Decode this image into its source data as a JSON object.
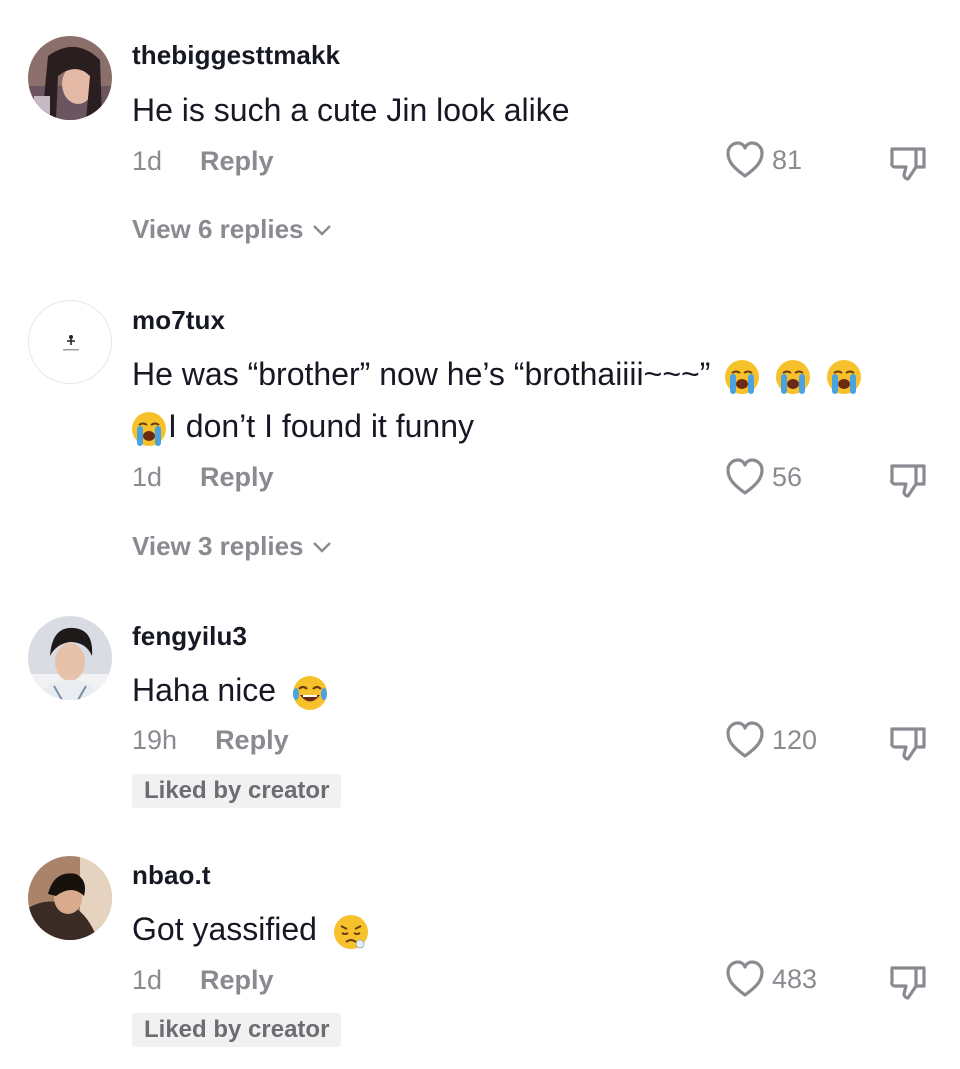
{
  "comments": [
    {
      "username": "thebiggesttmakk",
      "lines": [
        "He is such a cute Jin look alike"
      ],
      "time": "1d",
      "reply_label": "Reply",
      "likes": "81",
      "view_replies": "View 6 replies",
      "avatar_icon": "user-photo-avatar"
    },
    {
      "username": "mo7tux",
      "lines": [
        "He was “brother” now he’s “brothaiiii~~~”",
        "I don’t I found it funny"
      ],
      "time": "1d",
      "reply_label": "Reply",
      "likes": "56",
      "view_replies": "View 3 replies",
      "avatar_icon": "minimal-logo-avatar"
    },
    {
      "username": "fengyilu3",
      "lines": [
        "Haha nice"
      ],
      "time": "19h",
      "reply_label": "Reply",
      "likes": "120",
      "badge": "Liked by creator",
      "avatar_icon": "user-photo-avatar"
    },
    {
      "username": "nbao.t",
      "lines": [
        "Got yassified"
      ],
      "time": "1d",
      "reply_label": "Reply",
      "likes": "483",
      "badge": "Liked by creator",
      "avatar_icon": "user-photo-avatar"
    }
  ],
  "colors": {
    "text": "#161823",
    "muted": "#8a8b91",
    "badge_bg": "#f1f1f2"
  },
  "icons": {
    "like": "heart-outline-icon",
    "dislike": "thumbs-down-icon",
    "expand": "chevron-down-icon",
    "emoji_cry": "loudly-crying-face-emoji",
    "emoji_laugh": "tears-of-joy-emoji",
    "emoji_sad": "weary-face-emoji"
  }
}
